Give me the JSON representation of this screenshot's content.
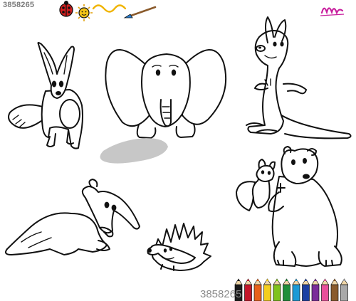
{
  "watermark": {
    "top_id": "3858265",
    "bottom_id": "3858265"
  },
  "image": {
    "subject": "coloring-page-animals",
    "colors": {
      "line": "#111111",
      "background": "#ffffff",
      "shadow": "#bdbdbd",
      "header_ladybug": "#d21f1f",
      "header_sun": "#f2c318",
      "header_brush_tip": "#2b7fd1",
      "logo_magenta": "#c81f9e"
    },
    "pencil_colors": [
      "#1a1a1a",
      "#c4162a",
      "#e8611a",
      "#f4cf1d",
      "#7fc31c",
      "#1f8f3b",
      "#1b9ad6",
      "#1c3fa3",
      "#7a2c9a",
      "#e84f9a",
      "#8a5a2b",
      "#a9a9a9"
    ]
  }
}
